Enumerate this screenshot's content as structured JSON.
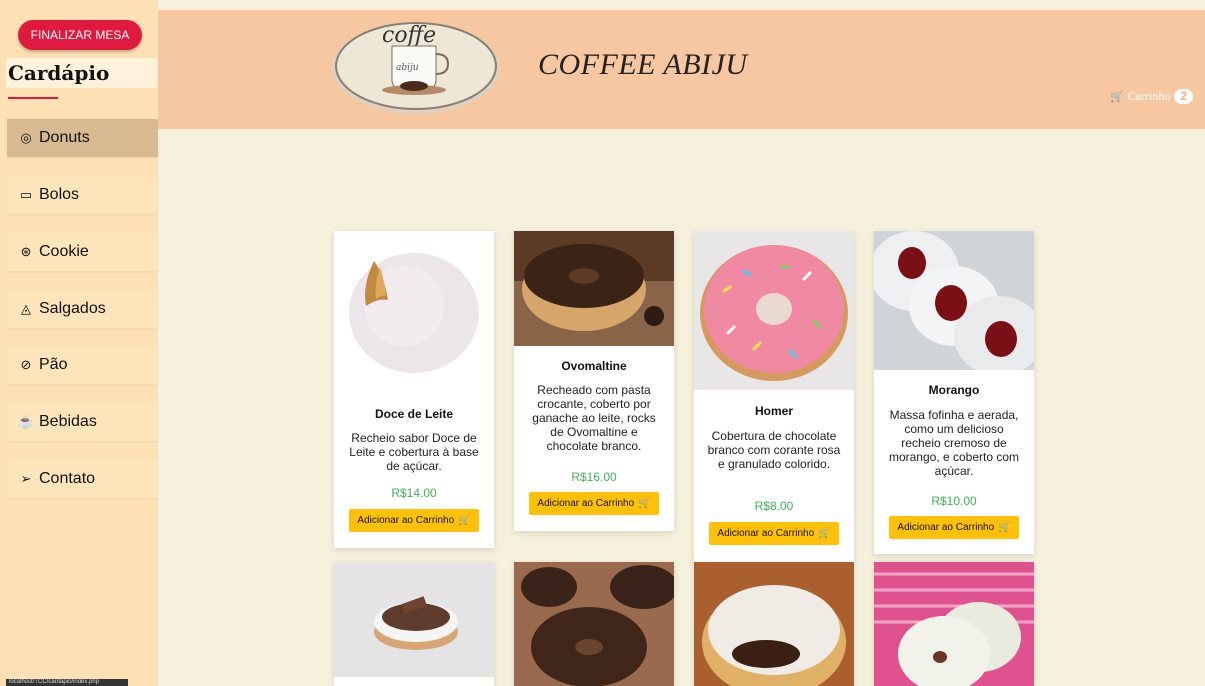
{
  "sidebar": {
    "finalize_button": "FINALIZAR MESA",
    "title": "Cardápio",
    "items": [
      {
        "label": "Donuts",
        "icon": "donut-icon",
        "glyph": "◎"
      },
      {
        "label": "Bolos",
        "icon": "cake-icon",
        "glyph": "▭"
      },
      {
        "label": "Cookie",
        "icon": "cookie-icon",
        "glyph": "⊛"
      },
      {
        "label": "Salgados",
        "icon": "cheese-icon",
        "glyph": "◬"
      },
      {
        "label": "Pão",
        "icon": "bread-icon",
        "glyph": "⊘"
      },
      {
        "label": "Bebidas",
        "icon": "cup-icon",
        "glyph": "☕"
      },
      {
        "label": "Contato",
        "icon": "send-icon",
        "glyph": "➢"
      }
    ],
    "active_item": "Donuts",
    "status_url": "localhost/TCC/cardapio/index.php"
  },
  "header": {
    "brand": "COFFEE ABIJU",
    "logo_text_top": "coffe",
    "logo_text_mug": "abiju",
    "cart_label": "Carrinho",
    "cart_count": "2"
  },
  "products": [
    {
      "name": "Doce de Leite",
      "description": "Recheio sabor Doce de Leite e cobertura à base de açúcar.",
      "price": "R$14.00",
      "button": "Adicionar ao Carrinho",
      "image": "donut-sugar-dulce-de-leche"
    },
    {
      "name": "Ovomaltine",
      "description": "Recheado com pasta crocante, coberto por ganache ao leite, rocks de Ovomaltine e chocolate branco.",
      "price": "R$16.00",
      "button": "Adicionar ao Carrinho",
      "image": "donut-chocolate-sprinkles"
    },
    {
      "name": "Homer",
      "description": "Cobertura de chocolate branco com corante rosa e granulado colorido.",
      "price": "R$8.00",
      "button": "Adicionar ao Carrinho",
      "image": "donut-pink-sprinkles"
    },
    {
      "name": "Morango",
      "description": "Massa fofinha e aerada, como um delicioso recheio cremoso de morango, e coberto com açúcar.",
      "price": "R$10.00",
      "button": "Adicionar ao Carrinho",
      "image": "donut-strawberry-filled"
    },
    {
      "image": "donut-white-chocolate-bar"
    },
    {
      "image": "donut-brigadeiro"
    },
    {
      "image": "donut-nutella-filled"
    },
    {
      "image": "donut-white-glazed"
    }
  ],
  "colors": {
    "header_bg": "#f7c7a1",
    "sidebar_bg": "#fde1b5",
    "page_bg": "#f4f0dc",
    "finalize_button": "#e0193f",
    "add_button": "#ffc107",
    "price": "#3cb554"
  }
}
